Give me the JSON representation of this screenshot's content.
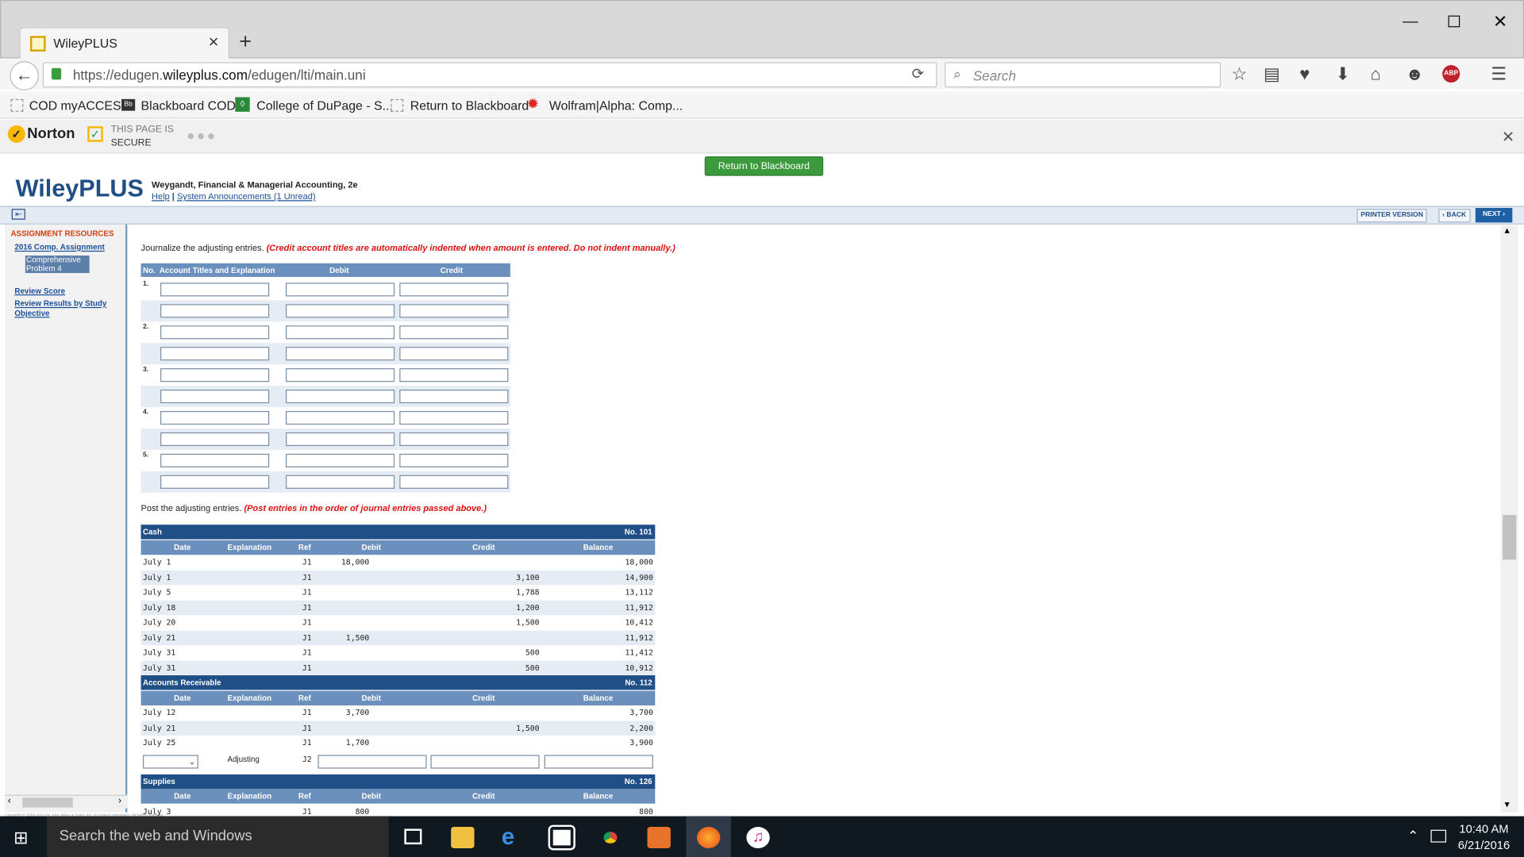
{
  "browser": {
    "tab_title": "WileyPLUS",
    "url_prefix": "https://edugen.",
    "url_domain": "wileyplus.com",
    "url_suffix": "/edugen/lti/main.uni",
    "search_placeholder": "Search",
    "bookmarks": [
      "COD myACCESS",
      "Blackboard COD",
      "College of DuPage - S...",
      "Return to Blackboard",
      "Wolfram|Alpha: Comp..."
    ],
    "norton": {
      "brand": "Norton",
      "status_line1": "THIS PAGE IS",
      "status_line2": "SECURE"
    },
    "abp": "ABP"
  },
  "header": {
    "return_button": "Return to Blackboard",
    "logo": "WileyPLUS",
    "course_title": "Weygandt, Financial & Managerial Accounting, 2e",
    "help": "Help",
    "separator": "|",
    "announcements": "System Announcements (1 Unread)",
    "printer_version": "PRINTER VERSION",
    "back": "‹ BACK",
    "next": "NEXT ›"
  },
  "sidebar": {
    "heading": "ASSIGNMENT RESOURCES",
    "assignment": "2016 Comp. Assignment",
    "selected_item": "Comprehensive Problem 4",
    "review_score": "Review Score",
    "review_results": "Review Results by Study Objective",
    "copyright": "Copyright © 2000-2016 by John Wiley & Sons, Inc. or related companies. All rights reserved."
  },
  "journal": {
    "instruction": "Journalize the adjusting entries.",
    "instruction_note": "(Credit account titles are automatically indented when amount is entered. Do not indent manually.)",
    "col_no": "No.",
    "col_account": "Account Titles and Explanation",
    "col_debit": "Debit",
    "col_credit": "Credit",
    "entries": [
      "1.",
      "2.",
      "3.",
      "4.",
      "5."
    ]
  },
  "posting": {
    "instruction": "Post the adjusting entries.",
    "instruction_note": "(Post entries in the order of journal entries passed above.)",
    "col_date": "Date",
    "col_explanation": "Explanation",
    "col_ref": "Ref",
    "col_debit": "Debit",
    "col_credit": "Credit",
    "col_balance": "Balance",
    "ledgers": [
      {
        "name": "Cash",
        "number": "No. 101",
        "rows": [
          {
            "date": "July 1",
            "ref": "J1",
            "debit": "18,000",
            "credit": "",
            "balance": "18,000"
          },
          {
            "date": "July 1",
            "ref": "J1",
            "debit": "",
            "credit": "3,100",
            "balance": "14,900"
          },
          {
            "date": "July 5",
            "ref": "J1",
            "debit": "",
            "credit": "1,788",
            "balance": "13,112"
          },
          {
            "date": "July 18",
            "ref": "J1",
            "debit": "",
            "credit": "1,200",
            "balance": "11,912"
          },
          {
            "date": "July 20",
            "ref": "J1",
            "debit": "",
            "credit": "1,500",
            "balance": "10,412"
          },
          {
            "date": "July 21",
            "ref": "J1",
            "debit": "1,500",
            "credit": "",
            "balance": "11,912"
          },
          {
            "date": "July 31",
            "ref": "J1",
            "debit": "",
            "credit": "500",
            "balance": "11,412"
          },
          {
            "date": "July 31",
            "ref": "J1",
            "debit": "",
            "credit": "500",
            "balance": "10,912"
          }
        ]
      },
      {
        "name": "Accounts Receivable",
        "number": "No. 112",
        "rows": [
          {
            "date": "July 12",
            "ref": "J1",
            "debit": "3,700",
            "credit": "",
            "balance": "3,700"
          },
          {
            "date": "July 21",
            "ref": "J1",
            "debit": "",
            "credit": "1,500",
            "balance": "2,200"
          },
          {
            "date": "July 25",
            "ref": "J1",
            "debit": "1,700",
            "credit": "",
            "balance": "3,900"
          }
        ],
        "adjusting": {
          "explanation": "Adjusting",
          "ref": "J2"
        }
      },
      {
        "name": "Supplies",
        "number": "No. 126",
        "rows": [
          {
            "date": "July 3",
            "ref": "J1",
            "debit": "800",
            "credit": "",
            "balance": "800"
          }
        ]
      }
    ]
  },
  "taskbar": {
    "search_placeholder": "Search the web and Windows",
    "time": "10:40 AM",
    "date": "6/21/2016"
  }
}
